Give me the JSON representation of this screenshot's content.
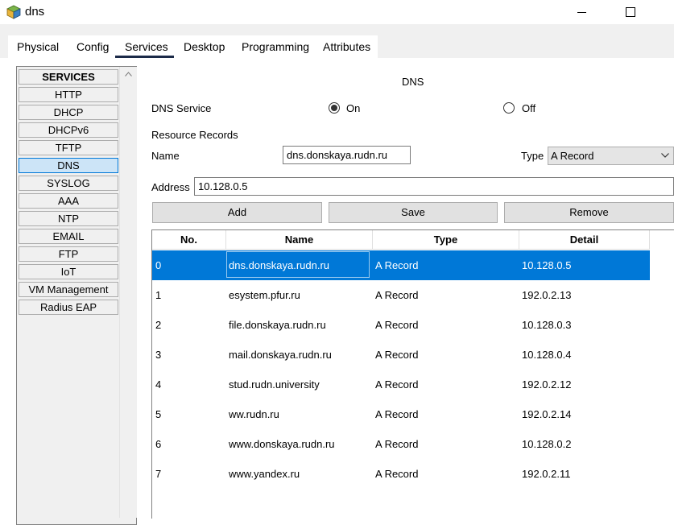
{
  "window": {
    "title": "dns",
    "app_icon": "packet-tracer-icon"
  },
  "tabs": [
    {
      "label": "Physical"
    },
    {
      "label": "Config"
    },
    {
      "label": "Services",
      "active": true
    },
    {
      "label": "Desktop"
    },
    {
      "label": "Programming"
    },
    {
      "label": "Attributes"
    }
  ],
  "sidebar": {
    "header": "SERVICES",
    "items": [
      "HTTP",
      "DHCP",
      "DHCPv6",
      "TFTP",
      "DNS",
      "SYSLOG",
      "AAA",
      "NTP",
      "EMAIL",
      "FTP",
      "IoT",
      "VM Management",
      "Radius EAP"
    ],
    "selected": "DNS"
  },
  "dns": {
    "panel_title": "DNS",
    "service_label": "DNS Service",
    "on_label": "On",
    "off_label": "Off",
    "service_state": "On",
    "resource_records_label": "Resource Records",
    "name_label": "Name",
    "name_value": "dns.donskaya.rudn.ru",
    "type_label": "Type",
    "type_value": "A Record",
    "address_label": "Address",
    "address_value": "10.128.0.5",
    "add_label": "Add",
    "save_label": "Save",
    "remove_label": "Remove"
  },
  "table": {
    "headers": [
      "No.",
      "Name",
      "Type",
      "Detail"
    ],
    "rows": [
      {
        "no": "0",
        "name": "dns.donskaya.rudn.ru",
        "type": "A Record",
        "detail": "10.128.0.5"
      },
      {
        "no": "1",
        "name": "esystem.pfur.ru",
        "type": "A Record",
        "detail": "192.0.2.13"
      },
      {
        "no": "2",
        "name": "file.donskaya.rudn.ru",
        "type": "A Record",
        "detail": "10.128.0.3"
      },
      {
        "no": "3",
        "name": "mail.donskaya.rudn.ru",
        "type": "A Record",
        "detail": "10.128.0.4"
      },
      {
        "no": "4",
        "name": "stud.rudn.university",
        "type": "A Record",
        "detail": "192.0.2.12"
      },
      {
        "no": "5",
        "name": "ww.rudn.ru",
        "type": "A Record",
        "detail": "192.0.2.14"
      },
      {
        "no": "6",
        "name": "www.donskaya.rudn.ru",
        "type": "A Record",
        "detail": "10.128.0.2"
      },
      {
        "no": "7",
        "name": "www.yandex.ru",
        "type": "A Record",
        "detail": "192.0.2.11"
      }
    ],
    "selected_row": 0
  },
  "colors": {
    "selection": "#0078d7",
    "selected_sidebar": "#cce4f7",
    "tab_underline": "#1b2a48"
  }
}
